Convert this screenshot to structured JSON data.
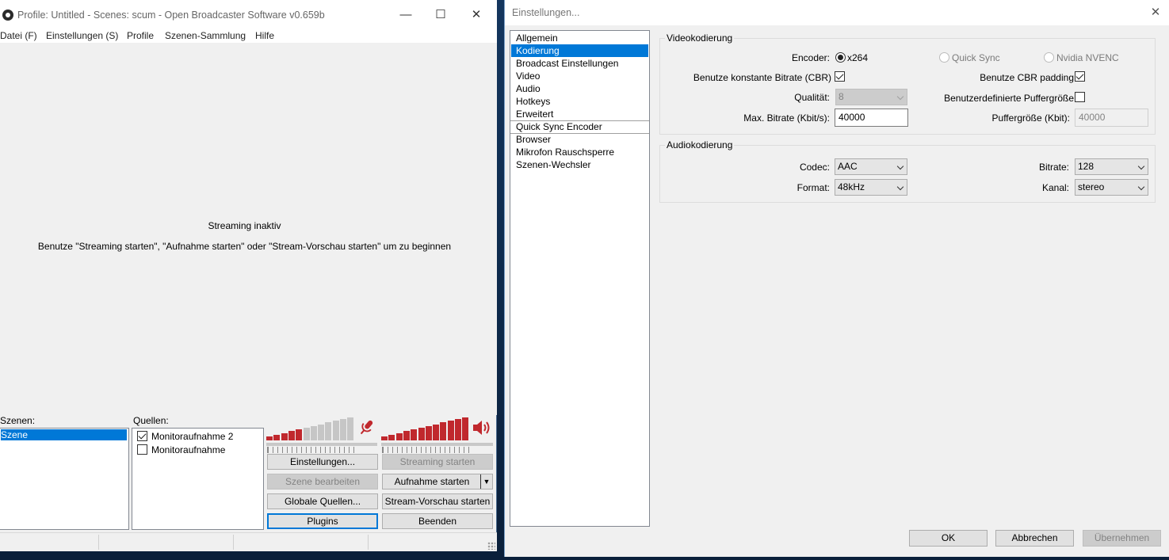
{
  "obs": {
    "title": "Profile: Untitled - Scenes: scum - Open Broadcaster Software v0.659b",
    "window_controls": {
      "minimize": "—",
      "maximize": "☐",
      "close": "✕"
    },
    "menu": [
      "Datei (F)",
      "Einstellungen (S)",
      "Profile",
      "Szenen-Sammlung",
      "Hilfe"
    ],
    "preview": {
      "status": "Streaming inaktiv",
      "hint": "Benutze \"Streaming starten\", \"Aufnahme starten\" oder \"Stream-Vorschau starten\" um zu beginnen"
    },
    "scenes_label": "Szenen:",
    "scenes": [
      "Szene"
    ],
    "sources_label": "Quellen:",
    "sources": [
      {
        "name": "Monitoraufnahme 2",
        "checked": true
      },
      {
        "name": "Monitoraufnahme",
        "checked": false
      }
    ],
    "mic_level": 0.45,
    "desktop_level": 1.0,
    "buttons": {
      "settings": "Einstellungen...",
      "start_streaming": "Streaming starten",
      "edit_scene": "Szene bearbeiten",
      "start_recording": "Aufnahme starten",
      "global_sources": "Globale Quellen...",
      "start_preview": "Stream-Vorschau starten",
      "plugins": "Plugins",
      "exit": "Beenden"
    },
    "colors": {
      "meter_active": "#c0282d",
      "meter_inactive": "#c6c6c6",
      "accent": "#0078d7"
    }
  },
  "settings": {
    "title": "Einstellungen...",
    "close": "✕",
    "nav": [
      "Allgemein",
      "Kodierung",
      "Broadcast Einstellungen",
      "Video",
      "Audio",
      "Hotkeys",
      "Erweitert",
      "Quick Sync Encoder",
      "Browser",
      "Mikrofon Rauschsperre",
      "Szenen-Wechsler"
    ],
    "nav_selected": "Kodierung",
    "video": {
      "group_title": "Videokodierung",
      "encoder_label": "Encoder:",
      "encoders": [
        "x264",
        "Quick Sync",
        "Nvidia NVENC"
      ],
      "encoder_selected": "x264",
      "cbr_label": "Benutze konstante Bitrate (CBR)",
      "cbr_checked": true,
      "cbr_padding_label": "Benutze CBR padding",
      "cbr_padding_checked": true,
      "quality_label": "Qualität:",
      "quality_value": "8",
      "custom_buffer_label": "Benutzerdefinierte Puffergröße",
      "custom_buffer_checked": false,
      "max_bitrate_label": "Max. Bitrate (Kbit/s):",
      "max_bitrate_value": "40000",
      "buffer_size_label": "Puffergröße (Kbit):",
      "buffer_size_value": "40000"
    },
    "audio": {
      "group_title": "Audiokodierung",
      "codec_label": "Codec:",
      "codec_value": "AAC",
      "bitrate_label": "Bitrate:",
      "bitrate_value": "128",
      "format_label": "Format:",
      "format_value": "48kHz",
      "channel_label": "Kanal:",
      "channel_value": "stereo"
    },
    "buttons": {
      "ok": "OK",
      "cancel": "Abbrechen",
      "apply": "Übernehmen"
    }
  }
}
